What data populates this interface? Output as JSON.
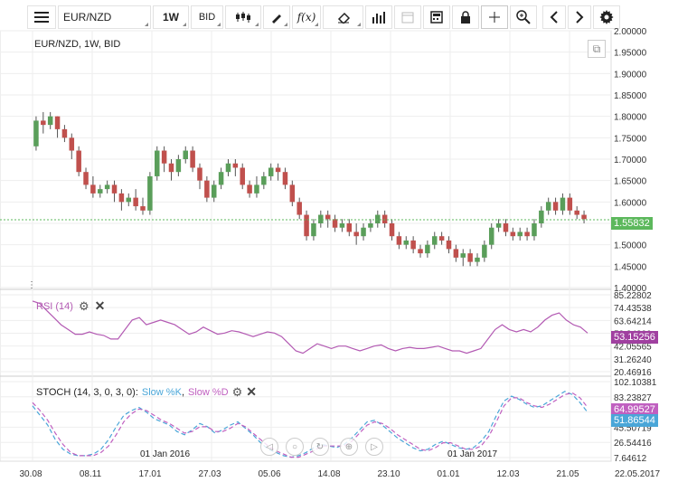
{
  "toolbar": {
    "symbol": "EUR/NZD",
    "interval": "1W",
    "price_type": "BID",
    "function_label": "f(x)"
  },
  "main_panel": {
    "title": "EUR/NZD, 1W, BID",
    "y_ticks": [
      "2.00000",
      "1.95000",
      "1.90000",
      "1.85000",
      "1.80000",
      "1.75000",
      "1.70000",
      "1.65000",
      "1.60000",
      "1.55000",
      "1.50000",
      "1.45000",
      "1.40000"
    ],
    "current_price": "1.55832",
    "current_price_color": "#5cb85c"
  },
  "rsi_panel": {
    "title": "RSI (14)",
    "title_color": "#b35ab3",
    "y_ticks": [
      "85.22802",
      "74.43538",
      "63.64214",
      "52.84890",
      "42.05565",
      "31.26240",
      "20.46916"
    ],
    "current_value": "53.15256",
    "current_color": "#a040a0"
  },
  "stoch_panel": {
    "title_prefix": "STOCH (14, 3, 0, 3, 0):",
    "k_label": "Slow %K",
    "d_label": "Slow %D",
    "separator": ",",
    "k_color": "#4aa6d8",
    "d_color": "#c060c0",
    "y_ticks": [
      "102.10381",
      "83.23827",
      "64.37273",
      "45.50719",
      "26.54416",
      "7.64612"
    ],
    "k_value": "64.99527",
    "d_value": "51.86544"
  },
  "x_axis": {
    "labels": [
      "30.08",
      "08.11",
      "17.01",
      "27.03",
      "05.06",
      "14.08",
      "23.10",
      "01.01",
      "12.03",
      "21.05"
    ],
    "end_date": "22.05.2017",
    "year_markers": [
      "01 Jan 2016",
      "01 Jan 2017"
    ]
  },
  "chart_data": {
    "type": "candlestick",
    "title": "EUR/NZD, 1W, BID",
    "ylim": [
      1.4,
      2.0
    ],
    "up_color": "#5a9e5a",
    "down_color": "#c0504d",
    "candles": [
      [
        1.73,
        1.79,
        1.8,
        1.72
      ],
      [
        1.79,
        1.78,
        1.81,
        1.76
      ],
      [
        1.78,
        1.8,
        1.81,
        1.77
      ],
      [
        1.8,
        1.77,
        1.8,
        1.75
      ],
      [
        1.77,
        1.75,
        1.78,
        1.74
      ],
      [
        1.75,
        1.72,
        1.76,
        1.7
      ],
      [
        1.72,
        1.67,
        1.73,
        1.66
      ],
      [
        1.67,
        1.64,
        1.68,
        1.63
      ],
      [
        1.64,
        1.62,
        1.66,
        1.61
      ],
      [
        1.62,
        1.63,
        1.64,
        1.61
      ],
      [
        1.63,
        1.64,
        1.65,
        1.62
      ],
      [
        1.64,
        1.62,
        1.65,
        1.6
      ],
      [
        1.62,
        1.6,
        1.63,
        1.58
      ],
      [
        1.6,
        1.61,
        1.62,
        1.59
      ],
      [
        1.61,
        1.59,
        1.63,
        1.58
      ],
      [
        1.59,
        1.58,
        1.61,
        1.57
      ],
      [
        1.58,
        1.66,
        1.67,
        1.57
      ],
      [
        1.66,
        1.72,
        1.73,
        1.65
      ],
      [
        1.72,
        1.69,
        1.73,
        1.67
      ],
      [
        1.69,
        1.67,
        1.7,
        1.65
      ],
      [
        1.67,
        1.7,
        1.71,
        1.66
      ],
      [
        1.7,
        1.72,
        1.73,
        1.69
      ],
      [
        1.72,
        1.68,
        1.73,
        1.67
      ],
      [
        1.68,
        1.65,
        1.69,
        1.63
      ],
      [
        1.65,
        1.61,
        1.66,
        1.6
      ],
      [
        1.61,
        1.64,
        1.65,
        1.6
      ],
      [
        1.64,
        1.67,
        1.68,
        1.63
      ],
      [
        1.67,
        1.69,
        1.7,
        1.66
      ],
      [
        1.69,
        1.68,
        1.7,
        1.66
      ],
      [
        1.68,
        1.64,
        1.69,
        1.63
      ],
      [
        1.64,
        1.62,
        1.65,
        1.61
      ],
      [
        1.62,
        1.64,
        1.66,
        1.61
      ],
      [
        1.64,
        1.66,
        1.67,
        1.63
      ],
      [
        1.66,
        1.68,
        1.69,
        1.65
      ],
      [
        1.68,
        1.67,
        1.69,
        1.65
      ],
      [
        1.67,
        1.64,
        1.68,
        1.63
      ],
      [
        1.64,
        1.6,
        1.65,
        1.59
      ],
      [
        1.6,
        1.57,
        1.61,
        1.56
      ],
      [
        1.57,
        1.52,
        1.58,
        1.51
      ],
      [
        1.52,
        1.55,
        1.56,
        1.51
      ],
      [
        1.55,
        1.57,
        1.58,
        1.54
      ],
      [
        1.57,
        1.56,
        1.58,
        1.54
      ],
      [
        1.56,
        1.54,
        1.57,
        1.53
      ],
      [
        1.54,
        1.55,
        1.56,
        1.53
      ],
      [
        1.55,
        1.53,
        1.56,
        1.52
      ],
      [
        1.53,
        1.52,
        1.55,
        1.5
      ],
      [
        1.52,
        1.54,
        1.55,
        1.51
      ],
      [
        1.54,
        1.55,
        1.56,
        1.53
      ],
      [
        1.55,
        1.57,
        1.58,
        1.54
      ],
      [
        1.57,
        1.55,
        1.58,
        1.54
      ],
      [
        1.55,
        1.52,
        1.56,
        1.51
      ],
      [
        1.52,
        1.5,
        1.53,
        1.49
      ],
      [
        1.5,
        1.51,
        1.52,
        1.49
      ],
      [
        1.51,
        1.49,
        1.52,
        1.48
      ],
      [
        1.49,
        1.48,
        1.5,
        1.47
      ],
      [
        1.48,
        1.5,
        1.51,
        1.47
      ],
      [
        1.5,
        1.52,
        1.53,
        1.49
      ],
      [
        1.52,
        1.51,
        1.53,
        1.5
      ],
      [
        1.51,
        1.49,
        1.52,
        1.48
      ],
      [
        1.49,
        1.47,
        1.5,
        1.46
      ],
      [
        1.47,
        1.48,
        1.49,
        1.45
      ],
      [
        1.48,
        1.46,
        1.49,
        1.45
      ],
      [
        1.46,
        1.47,
        1.48,
        1.45
      ],
      [
        1.47,
        1.5,
        1.51,
        1.46
      ],
      [
        1.5,
        1.54,
        1.55,
        1.49
      ],
      [
        1.54,
        1.55,
        1.56,
        1.53
      ],
      [
        1.55,
        1.53,
        1.56,
        1.52
      ],
      [
        1.53,
        1.52,
        1.54,
        1.51
      ],
      [
        1.52,
        1.53,
        1.54,
        1.51
      ],
      [
        1.53,
        1.52,
        1.54,
        1.51
      ],
      [
        1.52,
        1.55,
        1.56,
        1.51
      ],
      [
        1.55,
        1.58,
        1.59,
        1.54
      ],
      [
        1.58,
        1.6,
        1.61,
        1.57
      ],
      [
        1.6,
        1.58,
        1.61,
        1.57
      ],
      [
        1.58,
        1.61,
        1.62,
        1.57
      ],
      [
        1.61,
        1.58,
        1.62,
        1.57
      ],
      [
        1.58,
        1.57,
        1.59,
        1.56
      ],
      [
        1.57,
        1.56,
        1.58,
        1.55
      ]
    ],
    "rsi": [
      80,
      78,
      72,
      66,
      60,
      56,
      52,
      52,
      54,
      52,
      51,
      48,
      48,
      56,
      64,
      66,
      60,
      62,
      64,
      62,
      60,
      56,
      52,
      54,
      58,
      55,
      52,
      53,
      55,
      54,
      52,
      50,
      52,
      54,
      53,
      50,
      44,
      38,
      36,
      40,
      44,
      42,
      40,
      42,
      42,
      40,
      38,
      40,
      42,
      43,
      40,
      38,
      40,
      41,
      40,
      40,
      41,
      42,
      40,
      38,
      38,
      36,
      38,
      40,
      48,
      56,
      60,
      56,
      54,
      56,
      54,
      58,
      64,
      68,
      70,
      64,
      60,
      58,
      53
    ],
    "stoch_k": [
      72,
      60,
      48,
      30,
      18,
      12,
      10,
      10,
      12,
      18,
      30,
      46,
      60,
      66,
      70,
      64,
      56,
      52,
      48,
      40,
      36,
      42,
      50,
      46,
      38,
      42,
      48,
      52,
      44,
      36,
      26,
      18,
      14,
      10,
      8,
      10,
      14,
      20,
      24,
      22,
      20,
      24,
      32,
      42,
      52,
      54,
      48,
      40,
      32,
      26,
      20,
      16,
      18,
      24,
      28,
      24,
      20,
      18,
      20,
      28,
      40,
      60,
      78,
      84,
      80,
      74,
      70,
      72,
      78,
      84,
      90,
      86,
      76,
      64
    ],
    "stoch_d": [
      76,
      66,
      54,
      38,
      24,
      14,
      10,
      10,
      10,
      14,
      22,
      36,
      52,
      62,
      68,
      66,
      60,
      54,
      50,
      44,
      38,
      40,
      46,
      46,
      40,
      40,
      44,
      50,
      46,
      38,
      30,
      22,
      16,
      12,
      8,
      8,
      12,
      16,
      22,
      22,
      22,
      22,
      28,
      38,
      48,
      52,
      50,
      44,
      36,
      30,
      24,
      18,
      16,
      20,
      26,
      26,
      22,
      18,
      18,
      22,
      34,
      52,
      72,
      82,
      82,
      76,
      72,
      70,
      74,
      80,
      86,
      88,
      82,
      70
    ]
  }
}
